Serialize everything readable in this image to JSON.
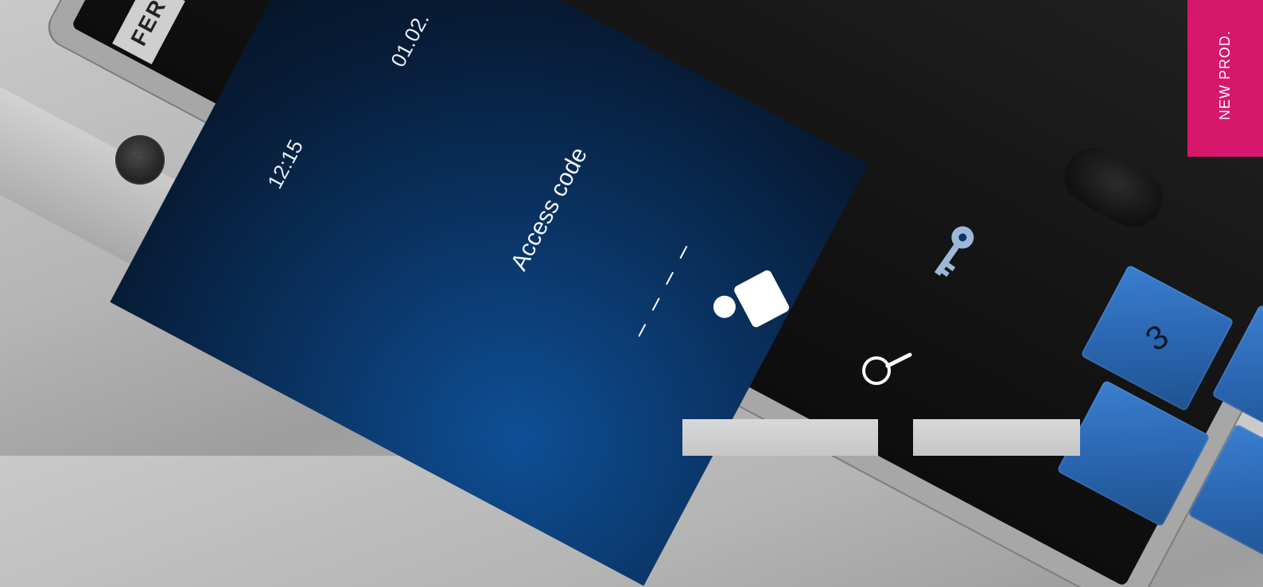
{
  "badge": {
    "text": "NEW PROD."
  },
  "brand": {
    "text": "FER"
  },
  "screen": {
    "time": "12:15",
    "date": "01.02.",
    "title": "Access code",
    "code_placeholder": "_ _ _ _"
  },
  "keypad": {
    "visible_key": "3"
  },
  "icons": [
    "person-icon",
    "key-icon",
    "search-icon",
    "camera-icon",
    "sensor-icon"
  ],
  "colors": {
    "badge": "#d6176c",
    "screen": "#0a3566",
    "keypad": "#2b67b2"
  }
}
